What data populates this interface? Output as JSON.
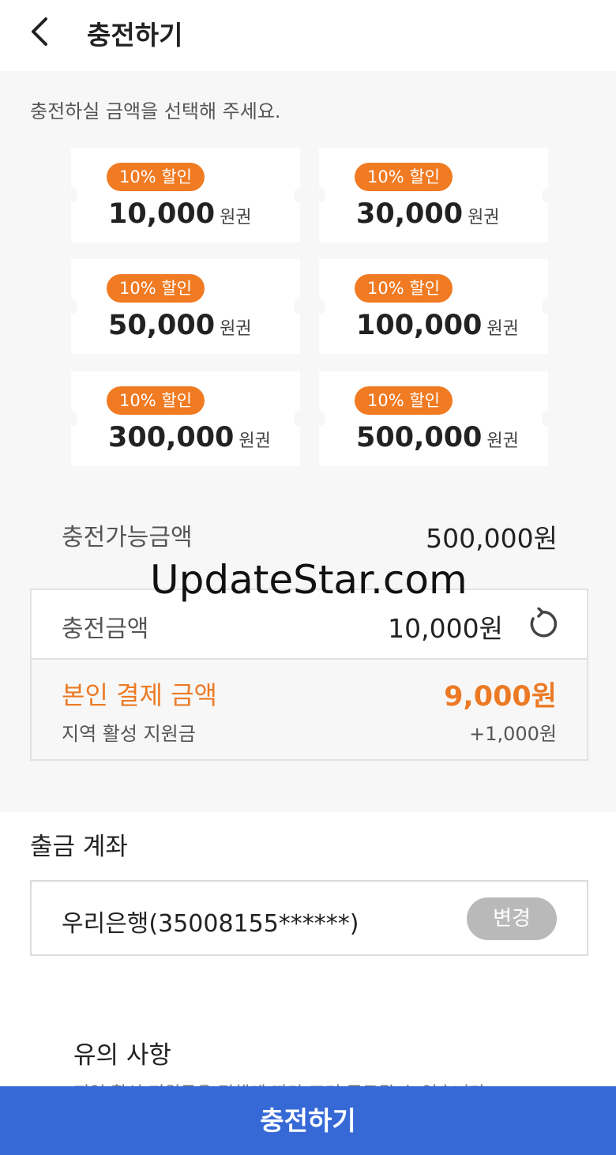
{
  "header": {
    "title": "충전하기",
    "back_icon": "chevron-left-icon"
  },
  "instruction": "충전하실 금액을 선택해 주세요.",
  "accent_color": "#f07b23",
  "cta_color": "#3669d6",
  "vouchers": [
    {
      "badge": "10% 할인",
      "amount": "10,000",
      "unit": "원권"
    },
    {
      "badge": "10% 할인",
      "amount": "30,000",
      "unit": "원권"
    },
    {
      "badge": "10% 할인",
      "amount": "50,000",
      "unit": "원권"
    },
    {
      "badge": "10% 할인",
      "amount": "100,000",
      "unit": "원권"
    },
    {
      "badge": "10% 할인",
      "amount": "300,000",
      "unit": "원권"
    },
    {
      "badge": "10% 할인",
      "amount": "500,000",
      "unit": "원권"
    }
  ],
  "available": {
    "label": "충전가능금액",
    "value": "500,000원"
  },
  "watermark": "UpdateStar.com",
  "summary": {
    "charge_label": "충전금액",
    "charge_value": "10,000원",
    "refresh_icon": "refresh-icon",
    "pay_label": "본인 결제 금액",
    "pay_value": "9,000원",
    "support_label": "지역 활성 지원금",
    "support_value": "+1,000원"
  },
  "account": {
    "title": "출금 계좌",
    "bank": "우리은행(35008155******)",
    "change_label": "변경"
  },
  "notice": {
    "title": "유의 사항",
    "text": "지역 활성 지원금은 정책에 따라 조기 종료될 수 있습니다."
  },
  "cta_label": "충전하기"
}
